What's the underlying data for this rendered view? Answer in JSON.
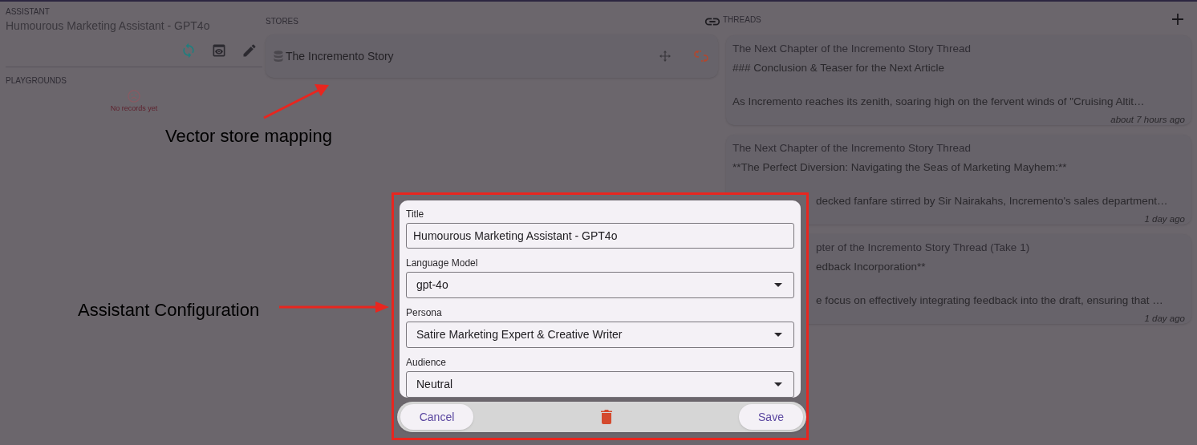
{
  "assistant": {
    "label": "ASSISTANT",
    "title": "Humourous Marketing Assistant - GPT4o"
  },
  "playgrounds": {
    "label": "PLAYGROUNDS",
    "empty_text": "No records yet"
  },
  "stores": {
    "label": "STORES",
    "items": [
      {
        "name": "The Incremento Story"
      }
    ]
  },
  "threads": {
    "label": "THREADS",
    "items": [
      {
        "title": "The Next Chapter of the Incremento Story Thread",
        "heading": "### Conclusion & Teaser for the Next Article",
        "excerpt": "As Incremento reaches its zenith, soaring high on the fervent winds of \"Cruising Altit…",
        "time": "about 7 hours ago",
        "kind": "full"
      },
      {
        "title": "The Next Chapter of the Incremento Story Thread",
        "heading": "**The Perfect Diversion: Navigating the Seas of Marketing Mayhem:**",
        "excerpt": "decked fanfare stirred by Sir Nairakahs, Incremento's sales department…",
        "time": "1 day ago",
        "kind": "partial"
      },
      {
        "title": "pter of the Incremento Story Thread (Take 1)",
        "heading": "edback Incorporation**",
        "excerpt": "e focus on effectively integrating feedback into the draft, ensuring that …",
        "time": "1 day ago",
        "kind": "covered"
      }
    ]
  },
  "dialog": {
    "fields": [
      {
        "kind": "text",
        "label": "Title",
        "value": "Humourous Marketing Assistant - GPT4o"
      },
      {
        "kind": "select",
        "label": "Language Model",
        "value": "gpt-4o"
      },
      {
        "kind": "select",
        "label": "Persona",
        "value": "Satire Marketing Expert & Creative Writer"
      },
      {
        "kind": "select",
        "label": "Audience",
        "value": "Neutral"
      }
    ],
    "cancel": "Cancel",
    "save": "Save"
  },
  "annotations": [
    {
      "text": "Vector store mapping"
    },
    {
      "text": "Assistant Configuration"
    }
  ]
}
